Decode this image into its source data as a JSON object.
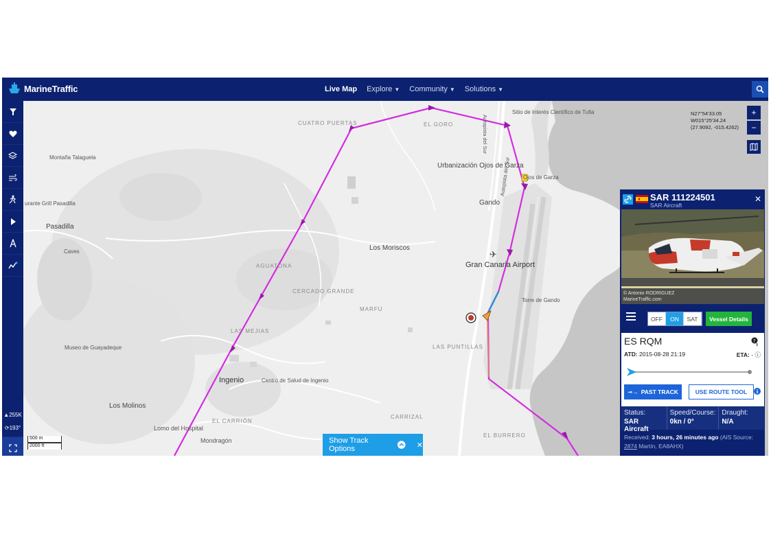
{
  "app": {
    "brand": "MarineTraffic"
  },
  "nav": {
    "live_map": "Live Map",
    "explore": "Explore",
    "community": "Community",
    "solutions": "Solutions"
  },
  "sidebar": {
    "items": [
      "filter-icon",
      "heart-icon",
      "layers-icon",
      "wind-icon",
      "density-icon",
      "play-icon",
      "weather-icon",
      "analytics-icon"
    ],
    "vessel_count": "255K",
    "heading": "193°"
  },
  "map": {
    "coords": [
      "N27°54'33.05",
      "W015°25'34.24",
      "(27.9092, -015.4262)"
    ],
    "labels": {
      "cuatro_puertas": "CUATRO PUERTAS",
      "el_goro": "EL GORO",
      "sitio": "Sitio de Interés Científico de Tufia",
      "montana": "Montaña Talaguela",
      "urbanizacion": "Urbanización Ojos de Garza",
      "autopista1": "Autopista del Sur",
      "autopista2": "Autopista del Sur",
      "ojos": "Ojos de Garza",
      "restaurante": "urante Grill Pasadilla",
      "gando": "Gando",
      "pasadilla": "Pasadilla",
      "los_moriscos": "Los Moriscos",
      "caves": "Caves",
      "aguatona": "AGUATONA",
      "airport": "Gran Canaria Airport",
      "cercado": "CERCADO GRANDE",
      "marfu": "MARFU",
      "torre": "Torre de Gando",
      "las_mejias": "LAS MEJIAS",
      "museo": "Museo de Guayadeque",
      "las_puntillas": "LAS PUNTILLAS",
      "ingenio": "Ingenio",
      "centro": "Centro de Salud de Ingenio",
      "los_molinos": "Los Molinos",
      "carrizal": "CARRIZAL",
      "el_carrion": "EL CARRIÓN",
      "lomo": "Lomo del Hospital",
      "mondragon": "Mondragón",
      "el_burrero": "EL BURRERO"
    },
    "scale_m": "500 m",
    "scale_ft": "2000 ft"
  },
  "track_options": {
    "label": "Show Track Options"
  },
  "vessel": {
    "name": "SAR 111224501",
    "type": "SAR Aircraft",
    "photo_credit_1": "© Antonio RODRIGUEZ",
    "photo_credit_2": "MarineTraffic.com",
    "toggle": [
      "OFF",
      "ON",
      "SAT"
    ],
    "toggle_selected": "ON",
    "details_button": "Vessel Details",
    "callsign_prefix": "ES",
    "callsign": "RQM",
    "atd_label": "ATD:",
    "atd_value": "2015-08-28 21:19",
    "eta_label": "ETA:",
    "eta_value": "-",
    "past_track": "PAST TRACK",
    "route_tool": "USE ROUTE TOOL",
    "status_label": "Status:",
    "status_value": "SAR Aircraft",
    "speed_label": "Speed/Course:",
    "speed_value": "0kn / 0°",
    "draught_label": "Draught:",
    "draught_value": "N/A",
    "received_label": "Received:",
    "received_value": "3 hours, 26 minutes ago",
    "ais_source_label": "(AIS Source:",
    "ais_source_id": "2874",
    "ais_source_name": "Martín, EA8AHX)"
  },
  "colors": {
    "navy": "#0c2270",
    "track": "#d42ce0",
    "accent": "#1fa0e6",
    "green": "#23b43d"
  }
}
